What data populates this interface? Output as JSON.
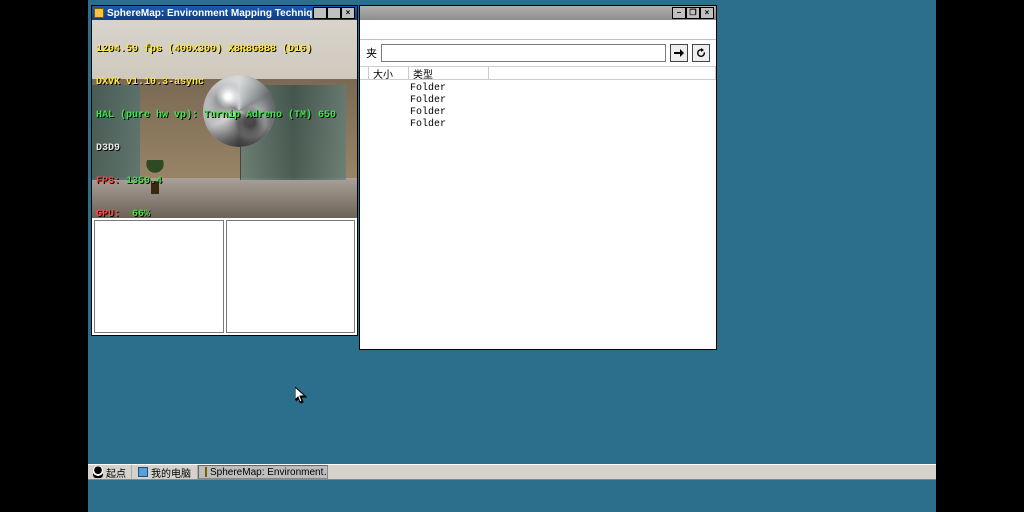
{
  "windows": {
    "sphere": {
      "title": "SphereMap: Environment Mapping Technique",
      "hud": {
        "line1": "1204.59 fps (400x300) X8R8G8B8 (D16)",
        "line2": "DXVK v1.10.3-async",
        "line3": "HAL (pure hw vp): Turnip Adreno (TM) 650",
        "line4": "D3D9",
        "fps_label": "FPS:",
        "fps_value": "1359.4",
        "gpu_label": "GPU:",
        "gpu_value": "66%"
      }
    },
    "browser": {
      "address_label": "夹",
      "address_value": "",
      "columns": {
        "size": "大小",
        "type": "类型"
      },
      "rows": [
        {
          "type": "Folder"
        },
        {
          "type": "Folder"
        },
        {
          "type": "Folder"
        },
        {
          "type": "Folder"
        }
      ]
    }
  },
  "taskbar": {
    "start": "起点",
    "items": [
      {
        "label": "我的电脑",
        "active": false
      },
      {
        "label": "SphereMap: Environment…",
        "active": true
      }
    ]
  },
  "icons": {
    "go": "go-arrow-icon",
    "refresh": "refresh-icon",
    "minimize": "–",
    "maximize": "□",
    "close": "×",
    "restore": "❐"
  }
}
